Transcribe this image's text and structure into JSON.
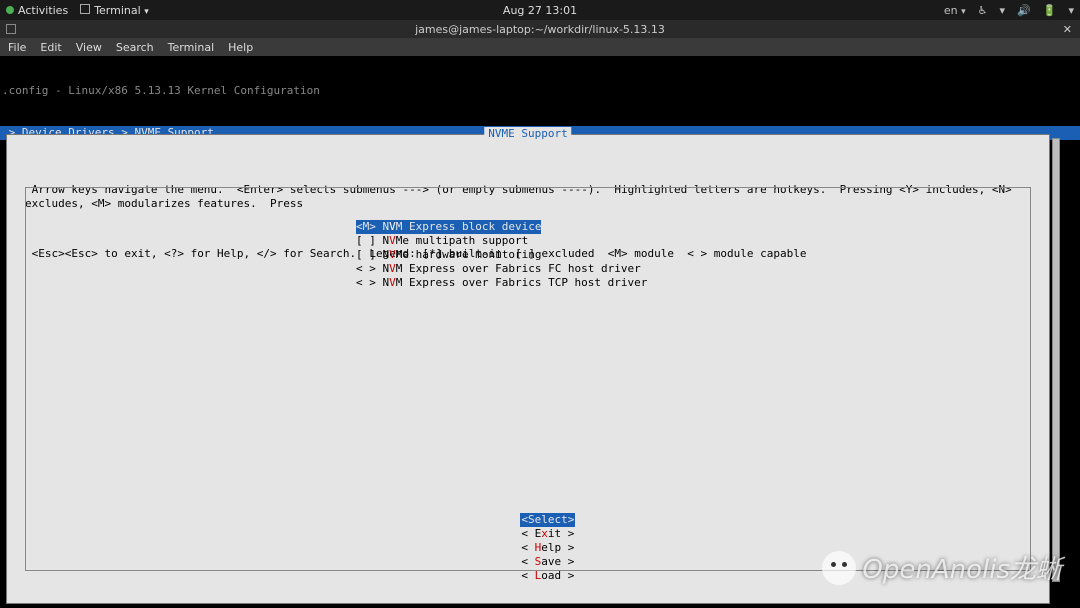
{
  "topbar": {
    "activities": "Activities",
    "app": "Terminal",
    "datetime": "Aug 27  13:01",
    "lang": "en"
  },
  "window": {
    "title": "james@james-laptop:~/workdir/linux-5.13.13"
  },
  "menubar": {
    "file": "File",
    "edit": "Edit",
    "view": "View",
    "search": "Search",
    "terminal": "Terminal",
    "help": "Help"
  },
  "kconfig": {
    "config_title": ".config - Linux/x86 5.13.13 Kernel Configuration",
    "breadcrumb": " > Device Drivers > NVME Support ",
    "frame_title": "NVME Support",
    "help1": " Arrow keys navigate the menu.  <Enter> selects submenus ---> (or empty submenus ----).  Highlighted letters are hotkeys.  Pressing <Y> includes, <N> excludes, <M> modularizes features.  Press",
    "help2": " <Esc><Esc> to exit, <?> for Help, </> for Search.  Legend: [*] built-in  [ ] excluded  <M> module  < > module capable",
    "options": [
      {
        "prefix": "<M> N",
        "hk": "V",
        "rest": "M Express block device",
        "selected": true
      },
      {
        "prefix": "[ ] N",
        "hk": "V",
        "rest": "Me multipath support",
        "selected": false
      },
      {
        "prefix": "[ ] N",
        "hk": "V",
        "rest": "Me hardware monitoring",
        "selected": false
      },
      {
        "prefix": "< > N",
        "hk": "V",
        "rest": "M Express over Fabrics FC host driver",
        "selected": false
      },
      {
        "prefix": "< > N",
        "hk": "V",
        "rest": "M Express over Fabrics TCP host driver",
        "selected": false
      }
    ],
    "buttons": {
      "select": "<Select>",
      "exit_l": "< E",
      "exit_hk": "x",
      "exit_r": "it >",
      "help_l": "< ",
      "help_hk": "H",
      "help_r": "elp >",
      "save_l": "< ",
      "save_hk": "S",
      "save_r": "ave >",
      "load_l": "< ",
      "load_hk": "L",
      "load_r": "oad >"
    }
  },
  "watermark": "OpenAnolis龙蜥"
}
